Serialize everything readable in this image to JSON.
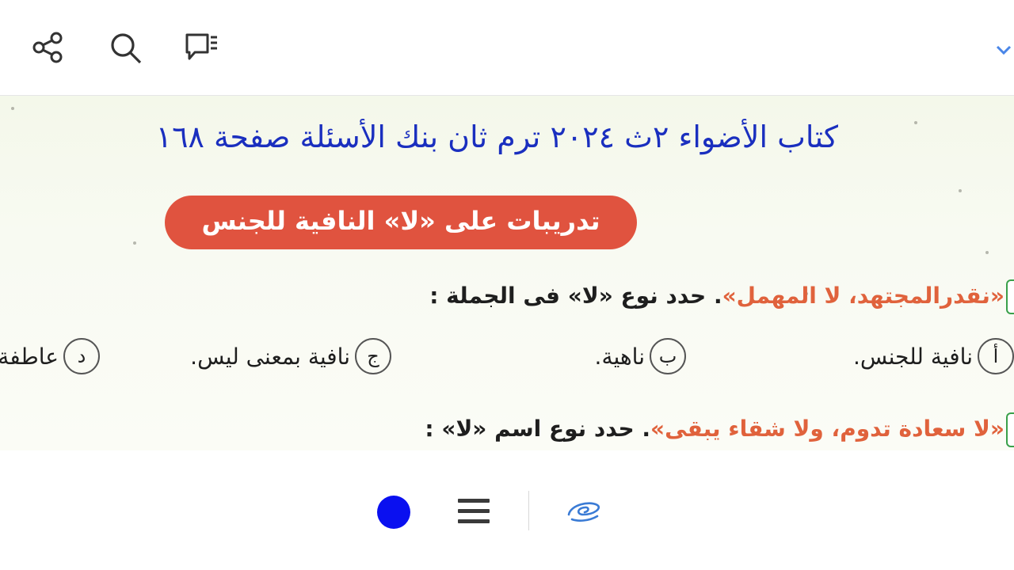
{
  "toolbar": {
    "share_icon": "share-icon",
    "search_icon": "search-icon",
    "comments_icon": "comment-list-icon",
    "expand_icon": "chevron-down-icon",
    "accent": "#4a86e8"
  },
  "page": {
    "title": "كتاب الأضواء ٢ث ٢٠٢٤ ترم ثان بنك الأسئلة صفحة ١٦٨",
    "title_color": "#1a2fbf",
    "banner": "تدريبات على «لا» النافية للجنس",
    "banner_color": "#e0533f",
    "question1": {
      "quote": "«نقدرالمجتهد، لا المهمل»",
      "instruction": ". حدد نوع «لا» فى الجملة :"
    },
    "options": [
      {
        "letter": "أ",
        "text": "نافية للجنس."
      },
      {
        "letter": "ب",
        "text": "ناهية."
      },
      {
        "letter": "ج",
        "text": "نافية بمعنى ليس."
      },
      {
        "letter": "د",
        "text": "عاطفة"
      }
    ],
    "question2": {
      "quote": "«لا سعادة تدوم، ولا شقاء يبقى»",
      "instruction": ". حدد نوع اسم «لا» :"
    }
  },
  "bottom_toolbar": {
    "color_icon": "color-dot-icon",
    "color": "#0a10f0",
    "menu_icon": "menu-icon",
    "pen_icon": "pen-scribble-icon"
  }
}
